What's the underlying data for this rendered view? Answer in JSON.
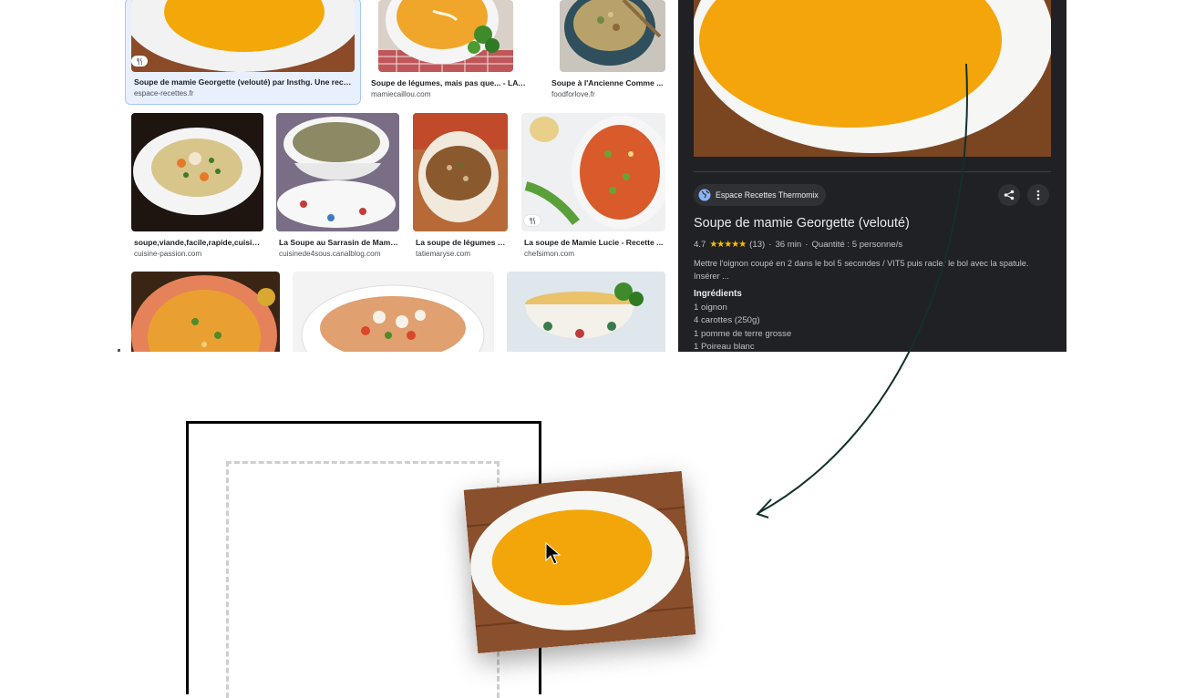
{
  "results": {
    "row1": [
      {
        "title": "Soupe de mamie Georgette (velouté) par Insthg. Une recet...",
        "source": "espace-recettes.fr",
        "badge_icon": "fork-knife-icon"
      },
      {
        "title": "Soupe de légumes, mais pas que... - LA C...",
        "source": "mamiecaillou.com"
      },
      {
        "title": "Soupe à l'Ancienne Comme ...",
        "source": "foodforlove.fr"
      }
    ],
    "row2": [
      {
        "title": "soupe,viande,facile,rapide,cuisin...",
        "source": "cuisine-passion.com"
      },
      {
        "title": "La Soupe au Sarrasin de Mami...",
        "source": "cuisinede4sous.canalblog.com"
      },
      {
        "title": "La soupe de légumes p...",
        "source": "tatiemaryse.com"
      },
      {
        "title": "La soupe de Mamie Lucie - Recette ...",
        "source": "chefsimon.com",
        "badge_icon": "fork-knife-icon"
      }
    ]
  },
  "panel": {
    "source_chip": "Espace Recettes Thermomix",
    "title": "Soupe de mamie Georgette (velouté)",
    "rating": "4.7",
    "stars": "★★★★★",
    "reviews": "(13)",
    "time": "36 min",
    "quantity": "Quantité : 5 personne/s",
    "description": "Mettre l'oignon coupé en 2 dans le bol 5 secondes / VIT5 puis racler le bol avec la spatule. Insérer ...",
    "ingredients_heading": "Ingrédients",
    "ingredients": [
      "1 oignon",
      "4 carottes (250g)",
      "1 pomme de terre grosse",
      "1 Poireau blanc"
    ],
    "share_icon": "share-icon",
    "more_icon": "more-vert-icon"
  },
  "drag": {
    "icon": "mouse-cursor-icon"
  },
  "colors": {
    "panel_bg": "#202124",
    "selected_bg": "#e8f0fe",
    "soup_orange": "#f0a000",
    "arrow": "#12302b"
  }
}
